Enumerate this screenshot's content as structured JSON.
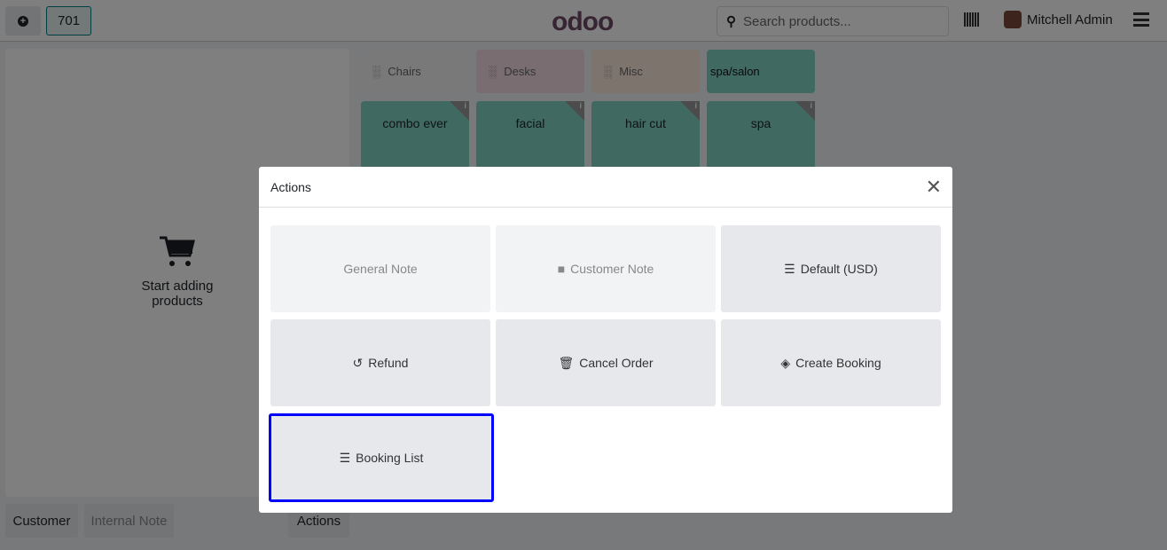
{
  "header": {
    "order_number": "701",
    "logo": "odoo",
    "search_placeholder": "Search products...",
    "user": "Mitchell Admin"
  },
  "left": {
    "empty_text": "Start adding products",
    "buttons": [
      "Customer",
      "Internal Note",
      "Actions"
    ]
  },
  "categories": [
    {
      "label": "Chairs",
      "color": "#f2f3f5"
    },
    {
      "label": "Desks",
      "color": "#f4dbe5"
    },
    {
      "label": "Misc",
      "color": "#fde9dd"
    },
    {
      "label": "spa/salon",
      "color": "#7ed3c3"
    }
  ],
  "products": [
    "combo ever",
    "facial",
    "hair cut",
    "spa"
  ],
  "modal": {
    "title": "Actions",
    "buttons": [
      {
        "label": "General Note",
        "icon": "",
        "state": "disabled"
      },
      {
        "label": "Customer Note",
        "icon": "note-icon",
        "state": "disabled"
      },
      {
        "label": "Default (USD)",
        "icon": "list-icon",
        "state": "normal"
      },
      {
        "label": "Refund",
        "icon": "undo-icon",
        "state": "normal"
      },
      {
        "label": "Cancel Order",
        "icon": "trash-icon",
        "state": "normal"
      },
      {
        "label": "Create Booking",
        "icon": "ticket-icon",
        "state": "normal"
      },
      {
        "label": "Booking List",
        "icon": "list-icon",
        "state": "selected"
      }
    ]
  }
}
